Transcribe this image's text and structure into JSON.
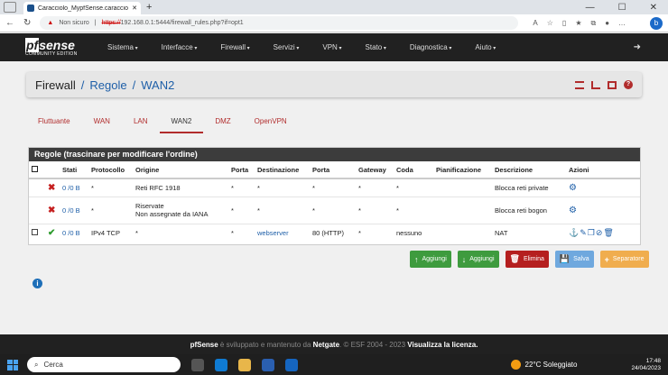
{
  "browser": {
    "tab_title": "Caracciolo_MypfSense.caraccio...",
    "new_tab": "+",
    "not_secure": "Non sicuro",
    "url_scheme": "https://",
    "url_rest": "192.168.0.1:5444/firewall_rules.php?if=opt1"
  },
  "navbar": {
    "logo_pf": "pf",
    "logo_sense": "sense",
    "logo_edition": "COMMUNITY EDITION",
    "menu": [
      "Sistema",
      "Interfacce",
      "Firewall",
      "Servizi",
      "VPN",
      "Stato",
      "Diagnostica",
      "Aiuto"
    ]
  },
  "breadcrumb": {
    "root": "Firewall",
    "sep": "/",
    "level2": "Regole",
    "level3": "WAN2"
  },
  "tabs": [
    "Fluttuante",
    "WAN",
    "LAN",
    "WAN2",
    "DMZ",
    "OpenVPN"
  ],
  "panel": {
    "title": "Regole (trascinare per modificare l'ordine)",
    "columns": [
      "Stati",
      "Protocollo",
      "Origine",
      "Porta",
      "Destinazione",
      "Porta",
      "Gateway",
      "Coda",
      "Pianificazione",
      "Descrizione",
      "Azioni"
    ],
    "rows": [
      {
        "status": "blocked",
        "states": "0 /0 B",
        "protocol": "*",
        "source": "Reti RFC 1918",
        "source2": "",
        "sport": "*",
        "dest": "*",
        "dport": "*",
        "gateway": "*",
        "queue": "*",
        "schedule": "",
        "description": "Blocca reti private"
      },
      {
        "status": "blocked",
        "states": "0 /0 B",
        "protocol": "*",
        "source": "Riservate",
        "source2": "Non assegnate da IANA",
        "sport": "*",
        "dest": "*",
        "dport": "*",
        "gateway": "*",
        "queue": "*",
        "schedule": "",
        "description": "Blocca reti bogon"
      },
      {
        "status": "pass",
        "states": "0 /0 B",
        "protocol": "IPv4 TCP",
        "source": "*",
        "source2": "",
        "sport": "*",
        "dest": "webserver",
        "dport": "80 (HTTP)",
        "gateway": "*",
        "queue": "nessuno",
        "schedule": "",
        "description": "NAT"
      }
    ]
  },
  "buttons": {
    "add_top": "Aggiungi",
    "add_bottom": "Aggiungi",
    "delete": "Elimina",
    "save": "Salva",
    "separator": "Separatore"
  },
  "footer": {
    "brand": "pfSense",
    "text1": " è sviluppato e mantenuto da ",
    "netgate": "Netgate",
    "text2": ". © ESF 2004 - 2023 ",
    "license": "Visualizza la licenza."
  },
  "taskbar": {
    "search": "Cerca",
    "weather": "22°C  Soleggiato",
    "time": "17:48",
    "date": "24/04/2023"
  },
  "colors": {
    "accent": "#b12c2c",
    "link": "#1e5fa8",
    "navbar": "#212121"
  }
}
